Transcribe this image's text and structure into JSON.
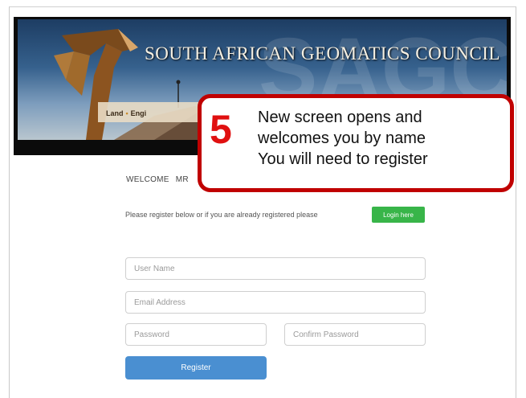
{
  "banner": {
    "title": "South African Geomatics Council",
    "title_display": "SOUTH  AFRICAN GEOMATICS  COUNCIL",
    "nav_items": [
      "Land",
      "Engi"
    ]
  },
  "welcome": {
    "label": "WELCOME",
    "name": "MR"
  },
  "register_note": "Please register below or if you are already registered please",
  "login_button": "Login here",
  "form": {
    "username_placeholder": "User Name",
    "email_placeholder": "Email Address",
    "password_placeholder": "Password",
    "confirm_placeholder": "Confirm Password",
    "register_button": "Register"
  },
  "callout": {
    "step": "5",
    "lines": [
      "New screen opens and",
      "welcomes you by name",
      "You will need to register"
    ]
  },
  "colors": {
    "callout_border": "#c00000",
    "login_button": "#38b549",
    "register_button": "#4a8fd1"
  }
}
